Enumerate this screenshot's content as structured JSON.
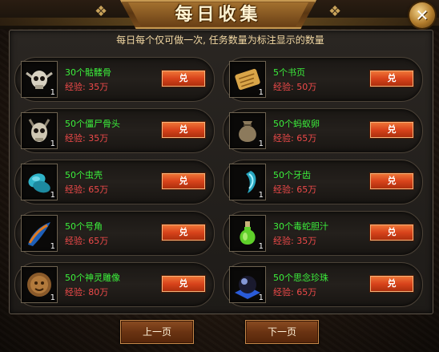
{
  "window": {
    "title": "每日收集",
    "close_label": "✕"
  },
  "notice": "每日每个仅可做一次, 任务数量为标注显示的数量",
  "items": [
    {
      "name": "30个骷髅骨",
      "exp": "经验: 35万",
      "count": "1",
      "button": "兑",
      "icon": "skull-icon"
    },
    {
      "name": "5个书页",
      "exp": "经验: 50万",
      "count": "1",
      "button": "兑",
      "icon": "scroll-icon"
    },
    {
      "name": "50个僵尸骨头",
      "exp": "经验: 35万",
      "count": "1",
      "button": "兑",
      "icon": "horned-skull-icon"
    },
    {
      "name": "50个蚂蚁卵",
      "exp": "经验: 65万",
      "count": "1",
      "button": "兑",
      "icon": "sack-icon"
    },
    {
      "name": "50个虫壳",
      "exp": "经验: 65万",
      "count": "1",
      "button": "兑",
      "icon": "shell-icon"
    },
    {
      "name": "50个牙齿",
      "exp": "经验: 65万",
      "count": "1",
      "button": "兑",
      "icon": "tooth-icon"
    },
    {
      "name": "50个号角",
      "exp": "经验: 65万",
      "count": "1",
      "button": "兑",
      "icon": "horn-icon"
    },
    {
      "name": "30个毒蛇胆汁",
      "exp": "经验: 35万",
      "count": "1",
      "button": "兑",
      "icon": "potion-icon"
    },
    {
      "name": "50个神灵雕像",
      "exp": "经验: 80万",
      "count": "1",
      "button": "兑",
      "icon": "idol-icon"
    },
    {
      "name": "50个思念珍珠",
      "exp": "经验: 65万",
      "count": "1",
      "button": "兑",
      "icon": "pearl-icon"
    }
  ],
  "pager": {
    "prev": "上一页",
    "next": "下一页"
  },
  "colors": {
    "item_name": "#3cf03c",
    "exp_text": "#f04a4a",
    "exchange_button": "#d8431b",
    "notice_text": "#f2d8a3"
  }
}
